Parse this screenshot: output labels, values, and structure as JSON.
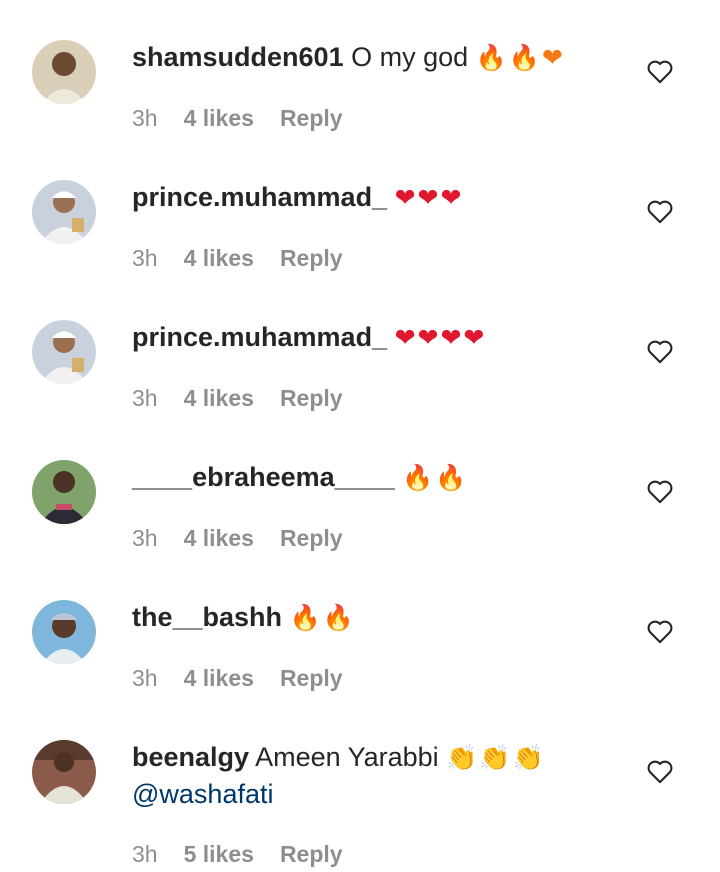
{
  "comments": [
    {
      "username": "shamsudden601",
      "text": "O my god",
      "emoji": "🔥🔥❤",
      "emoji_color": "mixed-fire-red",
      "mention": "",
      "time": "3h",
      "likes": "4 likes",
      "reply": "Reply",
      "avatar_colors": {
        "bg": "#d9cfb8",
        "skin": "#6b4a32",
        "cloth": "#efe9dc"
      }
    },
    {
      "username": "prince.muhammad_",
      "text": "",
      "emoji": "❤❤❤",
      "mention": "",
      "time": "3h",
      "likes": "4 likes",
      "reply": "Reply",
      "avatar_colors": {
        "bg": "#c9d2dc",
        "skin": "#9a6f52",
        "cloth": "#f1f1f1"
      }
    },
    {
      "username": "prince.muhammad_",
      "text": "",
      "emoji": "❤❤❤❤",
      "mention": "",
      "time": "3h",
      "likes": "4 likes",
      "reply": "Reply",
      "avatar_colors": {
        "bg": "#c9d2dc",
        "skin": "#9a6f52",
        "cloth": "#f1f1f1"
      }
    },
    {
      "username": "____ebraheema____",
      "text": "",
      "emoji": "🔥🔥",
      "mention": "",
      "time": "3h",
      "likes": "4 likes",
      "reply": "Reply",
      "avatar_colors": {
        "bg": "#7fa36a",
        "skin": "#4a3225",
        "cloth": "#2b2b35"
      }
    },
    {
      "username": "the__bashh",
      "text": "",
      "emoji": "🔥🔥",
      "mention": "",
      "time": "3h",
      "likes": "4 likes",
      "reply": "Reply",
      "avatar_colors": {
        "bg": "#7fb7dc",
        "skin": "#5a3b2a",
        "cloth": "#e9eef2"
      }
    },
    {
      "username": "beenalgy",
      "text": "Ameen Yarabbi",
      "emoji": "👏👏👏",
      "mention": "@washafati",
      "time": "3h",
      "likes": "5 likes",
      "reply": "Reply",
      "avatar_colors": {
        "bg": "#8a5a4a",
        "skin": "#4d3224",
        "cloth": "#e6e2d6"
      }
    }
  ],
  "colors": {
    "username": "#262626",
    "meta_gray": "#8e8e8e",
    "mention_blue": "#00376b",
    "heart_red": "#e0182d"
  },
  "icons": {
    "like": "heart-outline-icon"
  }
}
